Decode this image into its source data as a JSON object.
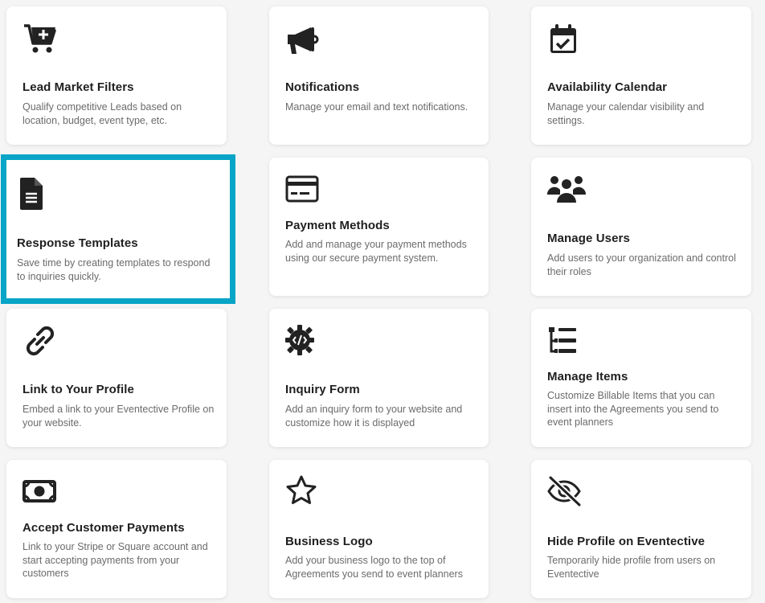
{
  "cards": [
    {
      "title": "Lead Market Filters",
      "description": "Qualify competitive Leads based on location, budget, event type, etc.",
      "icon": "cart-plus-icon"
    },
    {
      "title": "Notifications",
      "description": "Manage your email and text notifications.",
      "icon": "megaphone-icon"
    },
    {
      "title": "Availability Calendar",
      "description": "Manage your calendar visibility and settings.",
      "icon": "calendar-check-icon"
    },
    {
      "title": "Response Templates",
      "description": "Save time by creating templates to respond to inquiries quickly.",
      "icon": "document-icon"
    },
    {
      "title": "Payment Methods",
      "description": "Add and manage your payment methods using our secure payment system.",
      "icon": "credit-card-icon"
    },
    {
      "title": "Manage Users",
      "description": "Add users to your organization and control their roles",
      "icon": "users-icon"
    },
    {
      "title": "Link to Your Profile",
      "description": "Embed a link to your Eventective Profile on your website.",
      "icon": "link-icon"
    },
    {
      "title": "Inquiry Form",
      "description": "Add an inquiry form to your website and customize how it is displayed",
      "icon": "code-gear-icon"
    },
    {
      "title": "Manage Items",
      "description": "Customize Billable Items that you can insert into the Agreements you send to event planners",
      "icon": "list-tree-icon"
    },
    {
      "title": "Accept Customer Payments",
      "description": "Link to your Stripe or Square account and start accepting payments from your customers",
      "icon": "money-bill-icon"
    },
    {
      "title": "Business Logo",
      "description": "Add your business logo to the top of Agreements you send to event planners",
      "icon": "star-icon"
    },
    {
      "title": "Hide Profile on Eventective",
      "description": "Temporarily hide profile from users on Eventective",
      "icon": "eye-slash-icon"
    }
  ],
  "accent_color": "#08a5c7"
}
